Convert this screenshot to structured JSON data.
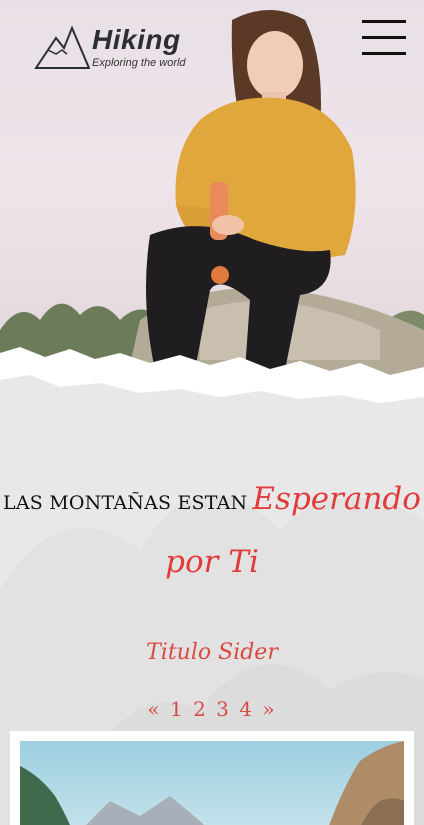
{
  "header": {
    "brand": "Hiking",
    "tagline": "Exploring the world",
    "logo_icon": "mountain-logo-icon",
    "menu_icon": "hamburger-menu-icon"
  },
  "hero": {
    "image": "woman-sitting-on-rock-photo"
  },
  "headline": {
    "dark_text": "LAS MONTAÑAS ESTAN",
    "red_text_1": "Esperando",
    "red_text_2": "por Ti"
  },
  "slider": {
    "title": "Titulo Sider",
    "prev": "«",
    "pages": [
      "1",
      "2",
      "3",
      "4"
    ],
    "next": "»"
  },
  "colors": {
    "accent": "#e23b3b",
    "text_dark": "#111111",
    "background": "#e8e8e8"
  }
}
